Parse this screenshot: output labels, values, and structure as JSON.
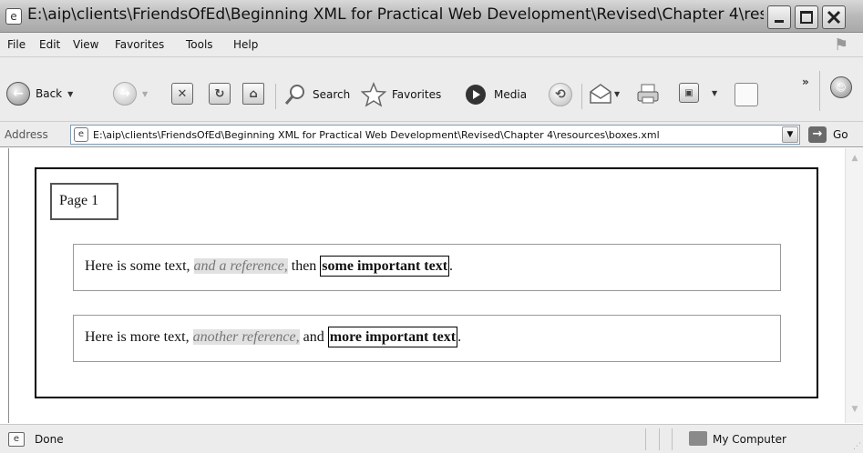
{
  "window": {
    "title": "E:\\aip\\clients\\FriendsOfEd\\Beginning XML for Practical Web Development\\Revised\\Chapter 4\\reso..."
  },
  "menu": {
    "items": [
      "File",
      "Edit",
      "View",
      "Favorites",
      "Tools",
      "Help"
    ]
  },
  "toolbar": {
    "back_label": "Back",
    "search_label": "Search",
    "favorites_label": "Favorites",
    "media_label": "Media",
    "overflow_label": "»"
  },
  "address": {
    "label": "Address",
    "value": "E:\\aip\\clients\\FriendsOfEd\\Beginning XML for Practical Web Development\\Revised\\Chapter 4\\resources\\boxes.xml",
    "go_label": "Go"
  },
  "content": {
    "page_label": "Page 1",
    "paragraphs": [
      {
        "text_before": "Here is some text, ",
        "reference": "and a reference,",
        "text_middle": " then ",
        "important": "some important text",
        "text_after": "."
      },
      {
        "text_before": "Here is more text, ",
        "reference": "another reference,",
        "text_middle": " and ",
        "important": "more important text",
        "text_after": "."
      }
    ]
  },
  "status": {
    "text": "Done",
    "zone": "My Computer"
  },
  "icons": {
    "app": "ie-page-icon",
    "back": "back-arrow-icon",
    "forward": "forward-arrow-icon",
    "stop": "stop-icon",
    "refresh": "refresh-icon",
    "home": "home-icon",
    "search": "search-icon",
    "favorites": "favorites-star-icon",
    "media": "media-icon",
    "history": "history-icon",
    "mail": "mail-icon",
    "print": "print-icon",
    "edit": "edit-icon",
    "discuss": "discuss-icon"
  }
}
